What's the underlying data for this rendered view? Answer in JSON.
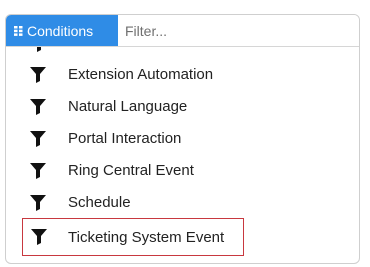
{
  "toolbar": {
    "conditions_label": "Conditions",
    "filter_placeholder": "Filter...",
    "button_color": "#2f8ce6"
  },
  "list": {
    "items": [
      {
        "label": "Extension Automation",
        "icon": "filter-funnel-icon"
      },
      {
        "label": "Natural Language",
        "icon": "filter-funnel-icon"
      },
      {
        "label": "Portal Interaction",
        "icon": "filter-funnel-icon"
      },
      {
        "label": "Ring Central Event",
        "icon": "filter-funnel-icon"
      },
      {
        "label": "Schedule",
        "icon": "filter-funnel-icon"
      },
      {
        "label": "Ticketing System Event",
        "icon": "filter-funnel-icon",
        "selected": true
      }
    ],
    "selected_outline_color": "#c8383f"
  }
}
